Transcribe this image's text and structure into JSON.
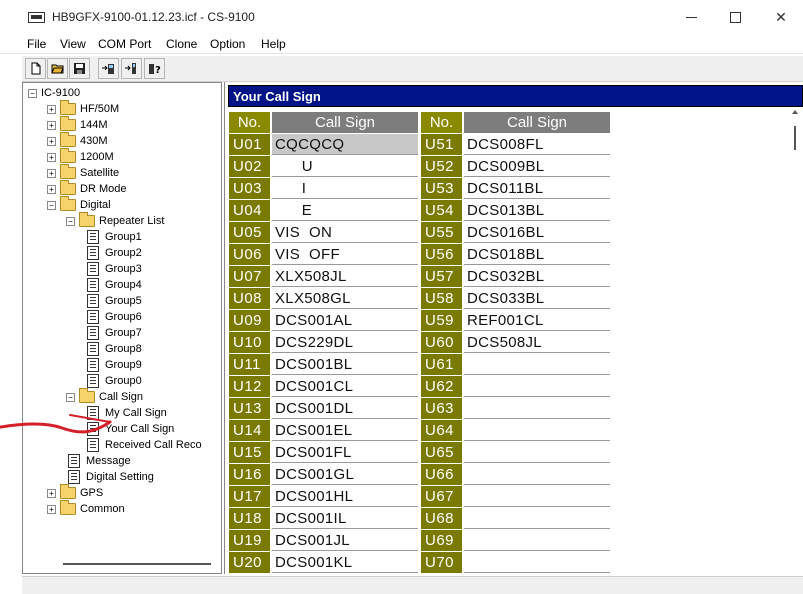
{
  "window": {
    "title": "HB9GFX-9100-01.12.23.icf - CS-9100",
    "minimize": "minimize",
    "maximize": "maximize",
    "close": "✕"
  },
  "menu": [
    "File",
    "View",
    "COM Port",
    "Clone",
    "Option",
    "Help"
  ],
  "toolbar": {
    "buttons": [
      "new-file-icon",
      "open-folder-icon",
      "save-disk-icon",
      "read-from-radio-icon",
      "write-to-radio-icon",
      "radio-info-icon"
    ]
  },
  "tree": {
    "root": "IC-9100",
    "items": [
      {
        "label": "HF/50M",
        "type": "folder",
        "expander": "+"
      },
      {
        "label": "144M",
        "type": "folder",
        "expander": "+"
      },
      {
        "label": "430M",
        "type": "folder",
        "expander": "+"
      },
      {
        "label": "1200M",
        "type": "folder",
        "expander": "+"
      },
      {
        "label": "Satellite",
        "type": "folder",
        "expander": "+"
      },
      {
        "label": "DR Mode",
        "type": "folder",
        "expander": "+"
      },
      {
        "label": "Digital",
        "type": "folder",
        "expander": "−"
      },
      {
        "label": "Repeater List",
        "type": "folder",
        "expander": "−"
      },
      {
        "label": "Group1",
        "type": "doc"
      },
      {
        "label": "Group2",
        "type": "doc"
      },
      {
        "label": "Group3",
        "type": "doc"
      },
      {
        "label": "Group4",
        "type": "doc"
      },
      {
        "label": "Group5",
        "type": "doc"
      },
      {
        "label": "Group6",
        "type": "doc"
      },
      {
        "label": "Group7",
        "type": "doc"
      },
      {
        "label": "Group8",
        "type": "doc"
      },
      {
        "label": "Group9",
        "type": "doc"
      },
      {
        "label": "Group0",
        "type": "doc"
      },
      {
        "label": "Call Sign",
        "type": "folder",
        "expander": "−"
      },
      {
        "label": "My Call Sign",
        "type": "doc"
      },
      {
        "label": "Your Call Sign",
        "type": "doc"
      },
      {
        "label": "Received Call Reco",
        "type": "doc"
      },
      {
        "label": "Message",
        "type": "doc"
      },
      {
        "label": "Digital Setting",
        "type": "doc"
      },
      {
        "label": "GPS",
        "type": "folder",
        "expander": "+"
      },
      {
        "label": "Common",
        "type": "folder",
        "expander": "+"
      }
    ]
  },
  "panel": {
    "title": "Your Call Sign",
    "headers": {
      "no": "No.",
      "callsign": "Call Sign"
    },
    "left_column": [
      {
        "no": "U01",
        "cs": "CQCQCQ"
      },
      {
        "no": "U02",
        "cs": "      U"
      },
      {
        "no": "U03",
        "cs": "      I"
      },
      {
        "no": "U04",
        "cs": "      E"
      },
      {
        "no": "U05",
        "cs": "VIS  ON"
      },
      {
        "no": "U06",
        "cs": "VIS  OFF"
      },
      {
        "no": "U07",
        "cs": "XLX508JL"
      },
      {
        "no": "U08",
        "cs": "XLX508GL"
      },
      {
        "no": "U09",
        "cs": "DCS001AL"
      },
      {
        "no": "U10",
        "cs": "DCS229DL"
      },
      {
        "no": "U11",
        "cs": "DCS001BL"
      },
      {
        "no": "U12",
        "cs": "DCS001CL"
      },
      {
        "no": "U13",
        "cs": "DCS001DL"
      },
      {
        "no": "U14",
        "cs": "DCS001EL"
      },
      {
        "no": "U15",
        "cs": "DCS001FL"
      },
      {
        "no": "U16",
        "cs": "DCS001GL"
      },
      {
        "no": "U17",
        "cs": "DCS001HL"
      },
      {
        "no": "U18",
        "cs": "DCS001IL"
      },
      {
        "no": "U19",
        "cs": "DCS001JL"
      },
      {
        "no": "U20",
        "cs": "DCS001KL"
      }
    ],
    "right_column": [
      {
        "no": "U51",
        "cs": "DCS008FL"
      },
      {
        "no": "U52",
        "cs": "DCS009BL"
      },
      {
        "no": "U53",
        "cs": "DCS011BL"
      },
      {
        "no": "U54",
        "cs": "DCS013BL"
      },
      {
        "no": "U55",
        "cs": "DCS016BL"
      },
      {
        "no": "U56",
        "cs": "DCS018BL"
      },
      {
        "no": "U57",
        "cs": "DCS032BL"
      },
      {
        "no": "U58",
        "cs": "DCS033BL"
      },
      {
        "no": "U59",
        "cs": "REF001CL"
      },
      {
        "no": "U60",
        "cs": "DCS508JL"
      },
      {
        "no": "U61",
        "cs": ""
      },
      {
        "no": "U62",
        "cs": ""
      },
      {
        "no": "U63",
        "cs": ""
      },
      {
        "no": "U64",
        "cs": ""
      },
      {
        "no": "U65",
        "cs": ""
      },
      {
        "no": "U66",
        "cs": ""
      },
      {
        "no": "U67",
        "cs": ""
      },
      {
        "no": "U68",
        "cs": ""
      },
      {
        "no": "U69",
        "cs": ""
      },
      {
        "no": "U70",
        "cs": ""
      }
    ],
    "selected": "U01"
  },
  "colors": {
    "header_bg": "#001487",
    "no_cell_bg": "#7a7a00",
    "callsign_header_bg": "#7d7d7d",
    "annotation": "#d4202a"
  }
}
